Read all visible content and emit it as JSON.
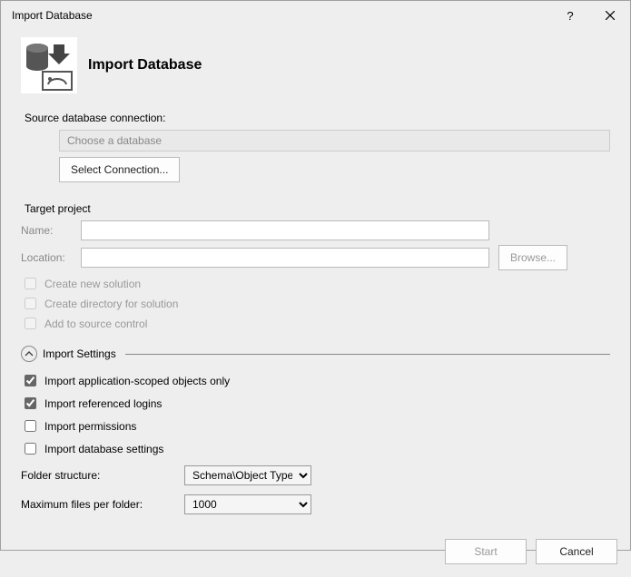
{
  "titlebar": {
    "title": "Import Database"
  },
  "header": {
    "title": "Import Database"
  },
  "source": {
    "label": "Source database connection:",
    "placeholder": "Choose a database",
    "select_button": "Select Connection..."
  },
  "target": {
    "section": "Target project",
    "name_label": "Name:",
    "name_value": "",
    "location_label": "Location:",
    "location_value": "",
    "browse_label": "Browse...",
    "create_solution": "Create new solution",
    "create_directory": "Create directory for solution",
    "add_source_control": "Add to source control"
  },
  "import": {
    "section": "Import Settings",
    "app_scoped": "Import application-scoped objects only",
    "ref_logins": "Import referenced logins",
    "permissions": "Import permissions",
    "db_settings": "Import database settings",
    "folder_label": "Folder structure:",
    "folder_value": "Schema\\Object Type",
    "maxfiles_label": "Maximum files per folder:",
    "maxfiles_value": "1000"
  },
  "footer": {
    "start": "Start",
    "cancel": "Cancel"
  }
}
